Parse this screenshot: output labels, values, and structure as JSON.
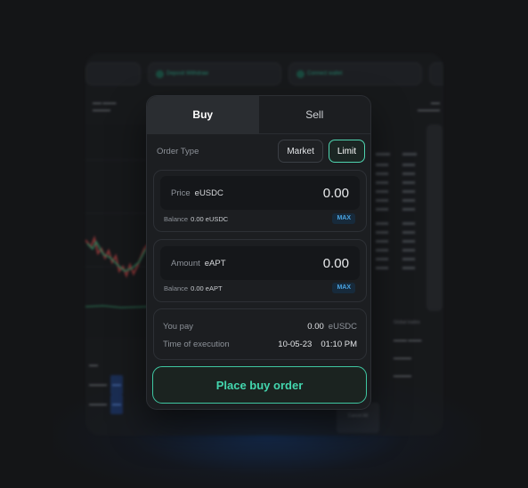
{
  "tabs": {
    "buy": "Buy",
    "sell": "Sell"
  },
  "order_type": {
    "label": "Order Type",
    "market": "Market",
    "limit": "Limit",
    "selected": "Limit"
  },
  "price": {
    "label": "Price",
    "unit": "eUSDC",
    "value": "0.00",
    "balance_label": "Balance",
    "balance_value": "0.00 eUSDC",
    "max": "MAX"
  },
  "amount": {
    "label": "Amount",
    "unit": "eAPT",
    "value": "0.00",
    "balance_label": "Balance",
    "balance_value": "0.00 eAPT",
    "max": "MAX"
  },
  "summary": {
    "you_pay_label": "You pay",
    "you_pay_value": "0.00",
    "you_pay_unit": "eUSDC",
    "time_label": "Time of execution",
    "time_date": "10-05-23",
    "time_clock": "01:10 PM"
  },
  "place_order": "Place buy order",
  "colors": {
    "accent": "#43d6ae",
    "max_badge": "#4aa3e0",
    "background": "#141517",
    "panel": "#1c1e21"
  },
  "background_app": {
    "deposit": "Deposit Withdraw",
    "connect": "Connect wallet",
    "global_trades": "Global trades",
    "cancel_all": "Cancel All"
  }
}
